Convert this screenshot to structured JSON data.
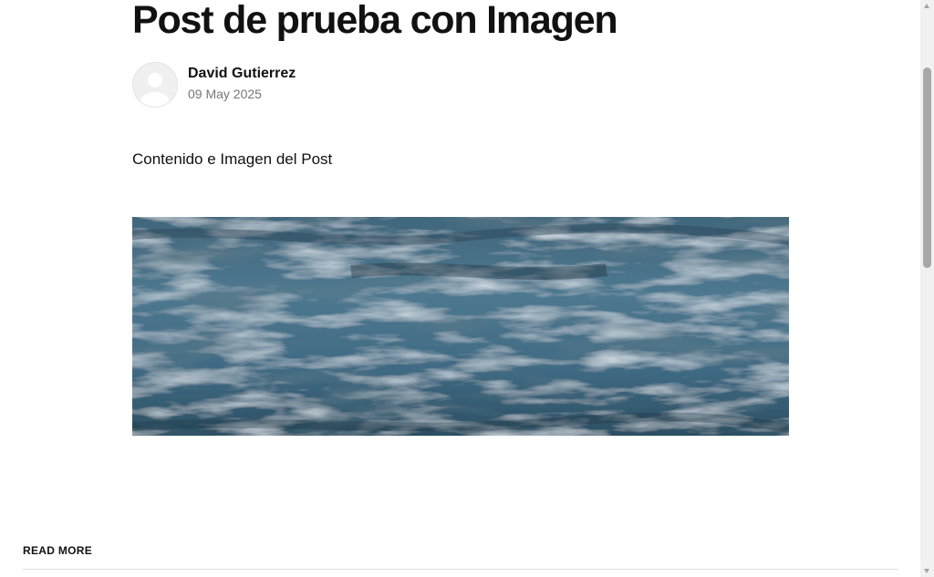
{
  "post": {
    "title": "Post de prueba con Imagen",
    "author": {
      "name": "David Gutierrez",
      "date": "09 May 2025",
      "avatar_icon": "default-user-avatar"
    },
    "content": "Contenido e Imagen del Post",
    "image": {
      "subject": "water-waves",
      "colors": [
        "#2f4f63",
        "#6b8aa0",
        "#b9cdd9"
      ]
    }
  },
  "footer": {
    "read_more_label": "READ MORE"
  },
  "scrollbar": {
    "position_fraction": 0.14
  }
}
